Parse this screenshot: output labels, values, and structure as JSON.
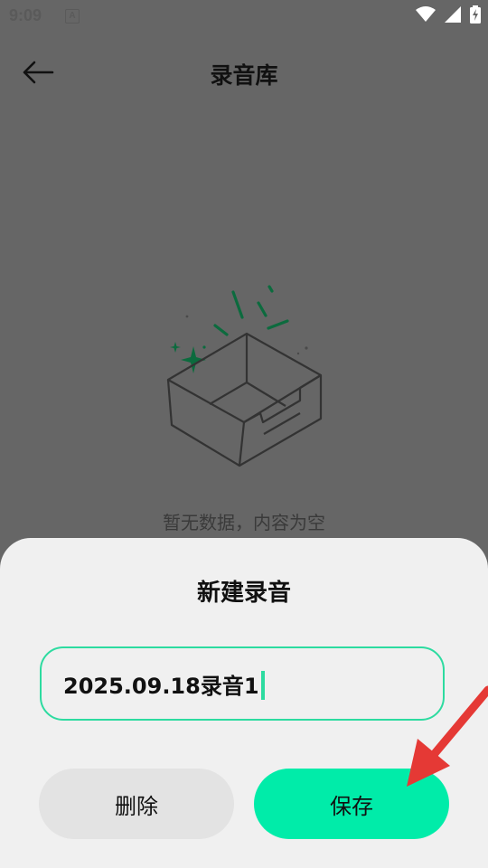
{
  "status_bar": {
    "time": "9:09",
    "notification_badge": "A"
  },
  "header": {
    "title": "录音库",
    "back_icon": "arrow-left-icon"
  },
  "empty_state": {
    "message": "暂无数据，内容为空",
    "illustration": "empty-box-icon"
  },
  "dialog": {
    "title": "新建录音",
    "input_value": "2025.09.18录音1",
    "delete_label": "删除",
    "save_label": "保存"
  },
  "colors": {
    "accent": "#00eca9",
    "input_border": "#2ddba0",
    "annotation_arrow": "#e53935",
    "overlay_bg": "#666666",
    "sheet_bg": "#f0f0f0"
  }
}
